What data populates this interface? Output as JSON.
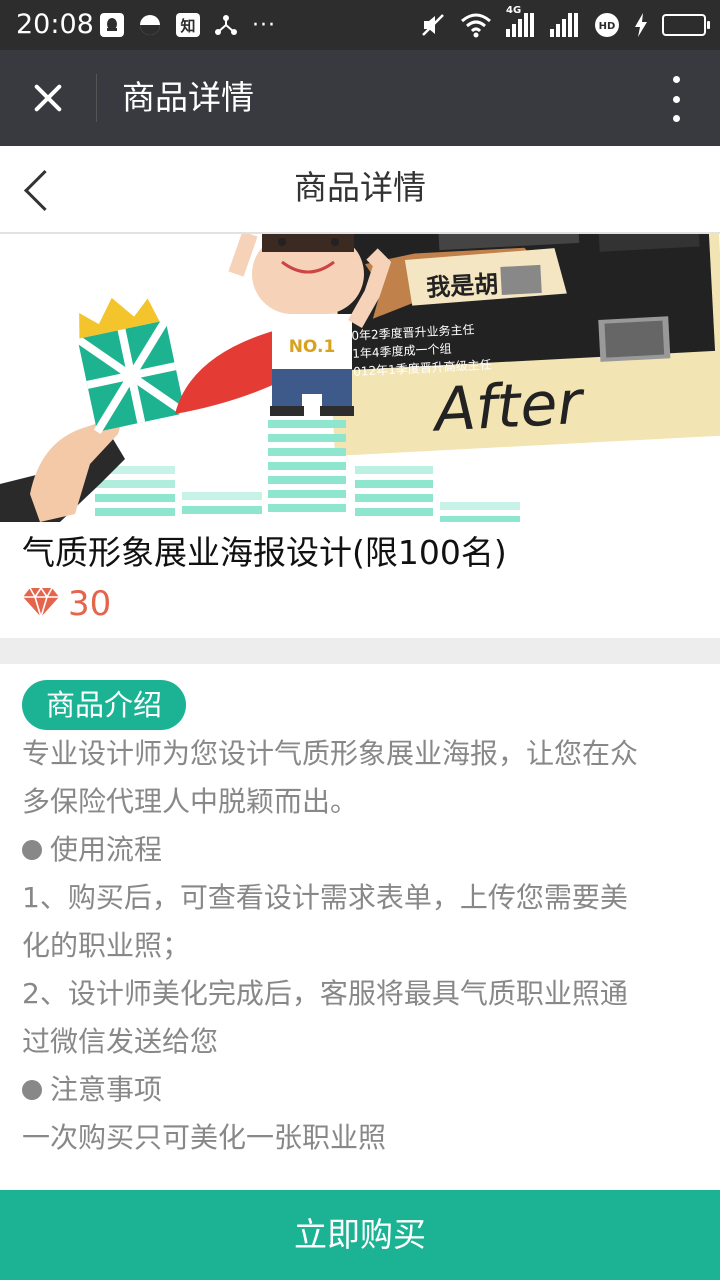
{
  "status_bar": {
    "time": "20:08",
    "network_label": "4G",
    "icons_left": [
      "qq-icon",
      "clock-icon",
      "zhihu-icon",
      "share-icon",
      "more-dots-icon"
    ],
    "zhihu_label": "知",
    "icons_right": [
      "mute-icon",
      "wifi-icon",
      "signal-4g-icon",
      "signal-icon",
      "hd-icon",
      "charging-icon",
      "battery-icon"
    ]
  },
  "titlebar": {
    "title": "商品详情"
  },
  "page_header": {
    "title": "商品详情"
  },
  "banner": {
    "badge_text": "NO.1",
    "ribbon_text": "我是胡",
    "lines": [
      "10年2季度晋升业务主任",
      "11年4季度成一个组",
      "2012年1季度晋升高级主任"
    ],
    "after_text": "After"
  },
  "product": {
    "title": "气质形象展业海报设计(限100名)",
    "price": "30",
    "price_icon": "diamond-icon",
    "price_color": "#e4644c"
  },
  "intro": {
    "tag": "商品介绍",
    "lines": [
      "专业设计师为您设计气质形象展业海报，让您在众",
      "多保险代理人中脱颖而出。",
      "使用流程",
      "1、购买后，可查看设计需求表单，上传您需要美",
      "化的职业照；",
      "2、设计师美化完成后，客服将最具气质职业照通",
      "过微信发送给您",
      "注意事项",
      "一次购买只可美化一张职业照"
    ]
  },
  "buy_button": {
    "label": "立即购买"
  },
  "colors": {
    "accent": "#1bb394",
    "titlebar": "#393a3f",
    "statusbar": "#2d2d2d"
  }
}
